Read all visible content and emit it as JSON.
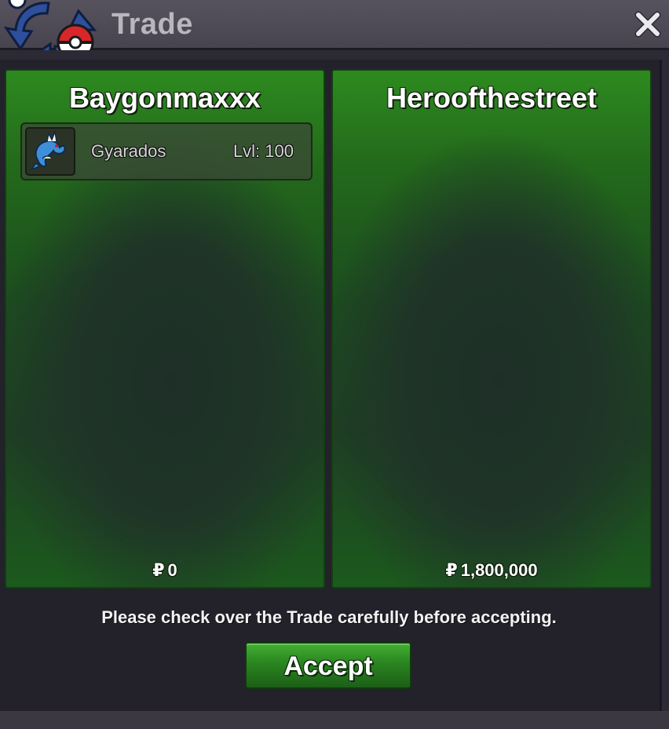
{
  "window": {
    "title": "Trade",
    "close_icon": "close-icon",
    "logo_icon": "trade-logo-icon"
  },
  "offers": [
    {
      "player": "Baygonmaxxx",
      "items": [
        {
          "icon": "gyarados-icon",
          "name": "Gyarados",
          "level": "Lvl: 100"
        }
      ],
      "currency_symbol": "₽",
      "money": "0"
    },
    {
      "player": "Heroofthestreet",
      "items": [],
      "currency_symbol": "₽",
      "money": "1,800,000"
    }
  ],
  "footer": {
    "notice": "Please check over the Trade carefully before accepting.",
    "accept_label": "Accept"
  },
  "colors": {
    "panel_green": "#236a1b",
    "accept_green": "#2a8420",
    "titlebar": "#4d4955"
  }
}
